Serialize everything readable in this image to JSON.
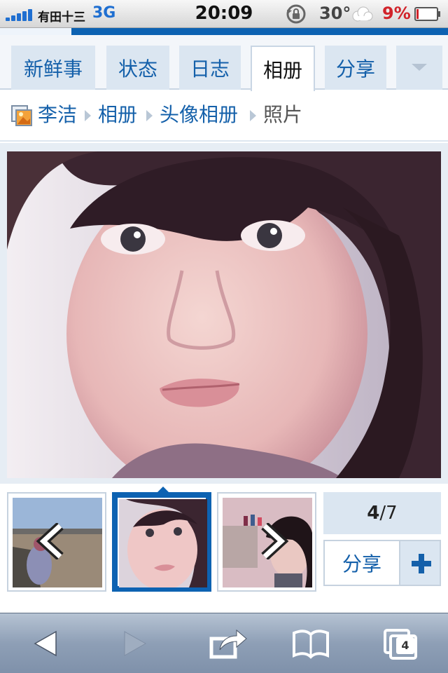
{
  "status_bar": {
    "carrier": "有田十三",
    "network": "3G",
    "time": "20:09",
    "temperature": "30°",
    "battery_percent": "9%",
    "signal_bars": 5
  },
  "page_load_progress": 0.16,
  "tabs": [
    {
      "label": "新鲜事",
      "active": false
    },
    {
      "label": "状态",
      "active": false
    },
    {
      "label": "日志",
      "active": false
    },
    {
      "label": "相册",
      "active": true
    },
    {
      "label": "分享",
      "active": false
    }
  ],
  "breadcrumb": {
    "user": "李洁",
    "album_root": "相册",
    "album": "头像相册",
    "current": "照片"
  },
  "photo": {
    "index": "4",
    "total": "/7"
  },
  "actions": {
    "share_label": "分享"
  },
  "toolbar": {
    "tabs_count": "4"
  },
  "colors": {
    "accent": "#0d62b2",
    "link": "#1460aa",
    "tab_bg": "#dbe6f1"
  }
}
